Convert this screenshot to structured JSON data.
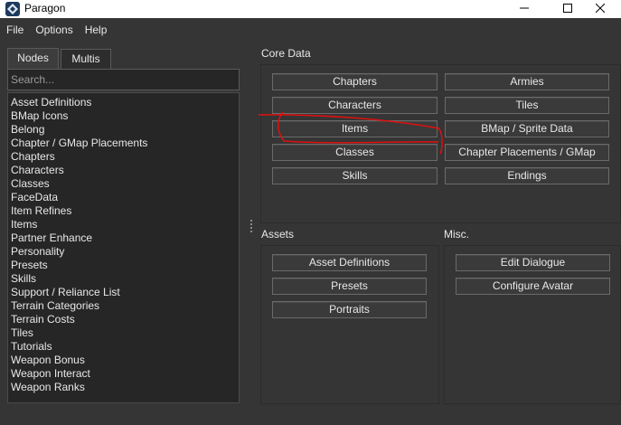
{
  "window": {
    "title": "Paragon"
  },
  "menu": {
    "items": [
      "File",
      "Options",
      "Help"
    ]
  },
  "sidebar": {
    "tabs": [
      "Nodes",
      "Multis"
    ],
    "active_tab": "Nodes",
    "search_placeholder": "Search...",
    "nodes": [
      "Asset Definitions",
      "BMap Icons",
      "Belong",
      "Chapter / GMap Placements",
      "Chapters",
      "Characters",
      "Classes",
      "FaceData",
      "Item Refines",
      "Items",
      "Partner Enhance",
      "Personality",
      "Presets",
      "Skills",
      "Support / Reliance List",
      "Terrain Categories",
      "Terrain Costs",
      "Tiles",
      "Tutorials",
      "Weapon Bonus",
      "Weapon Interact",
      "Weapon Ranks"
    ]
  },
  "core_data": {
    "title": "Core Data",
    "buttons": [
      "Chapters",
      "Armies",
      "Characters",
      "Tiles",
      "Items",
      "BMap / Sprite Data",
      "Classes",
      "Chapter Placements / GMap",
      "Skills",
      "Endings"
    ]
  },
  "assets": {
    "title": "Assets",
    "buttons": [
      "Asset Definitions",
      "Presets",
      "Portraits"
    ]
  },
  "misc": {
    "title": "Misc.",
    "buttons": [
      "Edit Dialogue",
      "Configure Avatar"
    ]
  },
  "colors": {
    "background": "#353535",
    "panel": "#262626",
    "button": "#3a3a3a",
    "annotation": "#e01010"
  },
  "icons": {
    "app": "app-diamond-icon",
    "minimize": "minimize-icon",
    "maximize": "maximize-icon",
    "close": "close-icon"
  }
}
